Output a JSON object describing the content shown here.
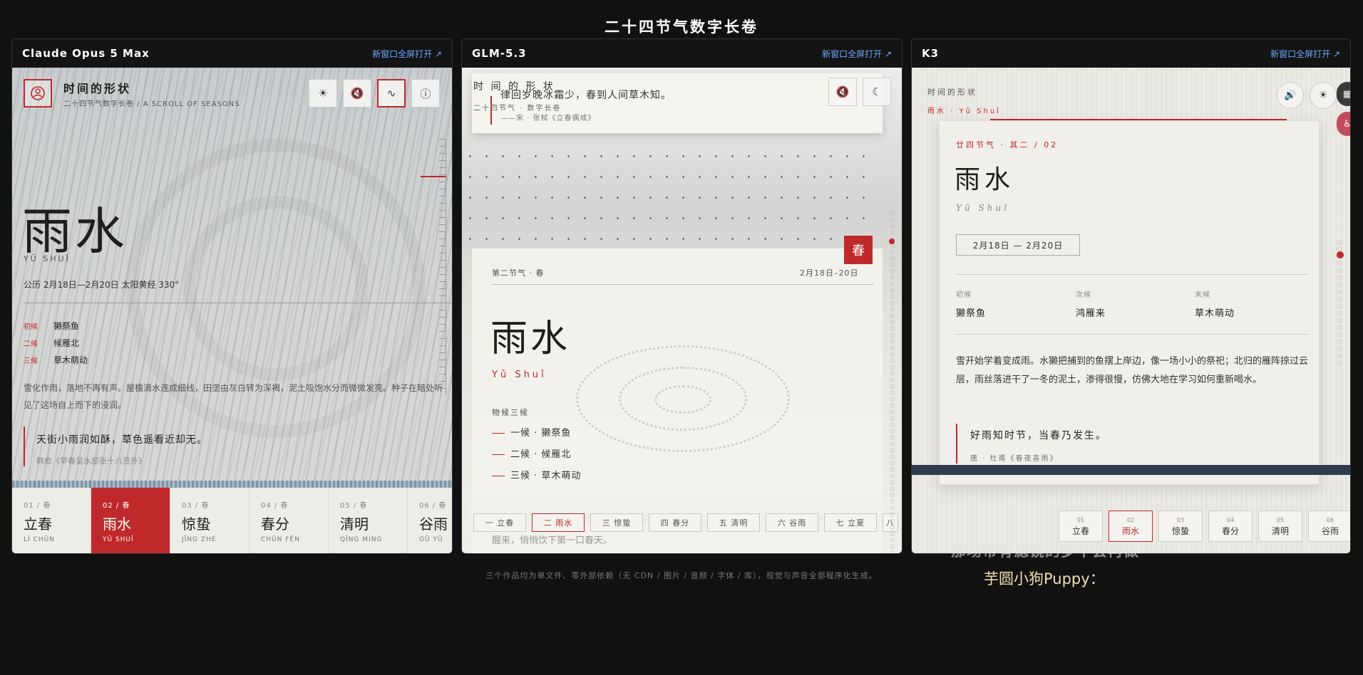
{
  "page": {
    "title": "二十四节气数字长卷",
    "footer": "三个作品均为单文件、零外部依赖（无 CDN / 图片 / 音频 / 字体 / 库），视觉与声音全部程序化生成。",
    "overlay_line1": "那场带有滤镜的梦不会再做",
    "overlay_line2": "芋圆小狗Puppy："
  },
  "colors": {
    "accent": "#c0292b",
    "background": "#111111",
    "link": "#6aa7ff"
  },
  "panels": [
    {
      "name": "Claude Opus 5 Max",
      "open_link": "新窗口全屏打开 ↗"
    },
    {
      "name": "GLM-5.3",
      "open_link": "新窗口全屏打开 ↗"
    },
    {
      "name": "K3",
      "open_link": "新窗口全屏打开 ↗"
    }
  ],
  "p1": {
    "app_title": "时间的形状",
    "app_sub": "二十四节气数字长卷 / A SCROLL OF SEASONS",
    "tools": [
      "sun-icon",
      "mute-icon",
      "wave-icon",
      "info-icon"
    ],
    "term": "雨水",
    "pinyin": "YŪ SHUǏ",
    "dates": "公历  2月18日—2月20日     太阳黄经  330°",
    "hou": [
      {
        "k": "初候",
        "v": "獭祭鱼"
      },
      {
        "k": "二候",
        "v": "候雁北"
      },
      {
        "k": "三候",
        "v": "草木萌动"
      }
    ],
    "desc": "雪化作雨，落地不再有声。屋檐滴水连成细线，田垄由灰白转为深褐，泥土吸饱水分而微微发亮。种子在暗处听见了这场自上而下的浸润。",
    "quote": "天街小雨润如酥，草色遥看近却无。",
    "quote_src": "韩愈《早春呈水部张十八员外》",
    "tabs": [
      {
        "n": "01 / 春",
        "z": "立春",
        "py": "LÌ CHŪN"
      },
      {
        "n": "02 / 春",
        "z": "雨水",
        "py": "YǓ SHUǏ"
      },
      {
        "n": "03 / 春",
        "z": "惊蛰",
        "py": "JĪNG ZHÉ"
      },
      {
        "n": "04 / 春",
        "z": "春分",
        "py": "CHŪN FĒN"
      },
      {
        "n": "05 / 春",
        "z": "清明",
        "py": "QĪNG MÍNG"
      },
      {
        "n": "06 / 春",
        "z": "谷雨",
        "py": "GǓ YǓ"
      }
    ]
  },
  "p2": {
    "tc_title": "时 间 的 形 状",
    "tc_sub": "二十四节气 · 数字长卷",
    "tc_verse": "律回岁晚冰霜少，春到人间草木知。",
    "tc_src": "——宋 · 张栻《立春偶成》",
    "badge": "春",
    "meta_l": "第二节气 · 春",
    "meta_r": "2月18日–20日",
    "term": "雨水",
    "pinyin": "Yǔ Shuǐ",
    "wuhou_label": "物候三候",
    "hou": [
      "一候 · 獭祭鱼",
      "二候 · 候雁北",
      "三候 · 草木萌动"
    ],
    "bottom_verse": "天街小雨润如酥，草色遥看近却无。獭祭鱼，候雁北，水汽催人去年旧草锦，新木须先于叶芽醒来，悄悄饮下第一口春天。",
    "tabs": [
      "一 立春",
      "二 雨水",
      "三 惊蛰",
      "四 春分",
      "五 清明",
      "六 谷雨",
      "七 立夏",
      "八"
    ],
    "tools": [
      "mute-icon",
      "moon-icon"
    ]
  },
  "p3": {
    "tiny_title": "时间的形状",
    "tiny_sub": "雨水 · Yǔ Shuǐ",
    "kicker": "廿四节气 · 其二 / 02",
    "term": "雨水",
    "pinyin": "Yǔ Shuǐ",
    "dates": "2月18日 — 2月20日",
    "hou": [
      {
        "k": "初候",
        "v": "獭祭鱼"
      },
      {
        "k": "次候",
        "v": "鸿雁来"
      },
      {
        "k": "末候",
        "v": "草木萌动"
      }
    ],
    "desc": "雪开始学着变成雨。水獭把捕到的鱼摆上岸边，像一场小小的祭祀；北归的雁阵掠过云层，雨丝落进干了一冬的泥土，渗得很慢，仿佛大地在学习如何重新喝水。",
    "quote": "好雨知时节，当春乃发生。",
    "quote_src": "唐 · 杜甫《春夜喜雨》",
    "tabs": [
      {
        "n": "01",
        "z": "立春"
      },
      {
        "n": "02",
        "z": "雨水"
      },
      {
        "n": "03",
        "z": "惊蛰"
      },
      {
        "n": "04",
        "z": "春分"
      },
      {
        "n": "05",
        "z": "清明"
      },
      {
        "n": "06",
        "z": "谷雨"
      }
    ],
    "tools": [
      "speaker-icon",
      "sun-icon"
    ]
  }
}
